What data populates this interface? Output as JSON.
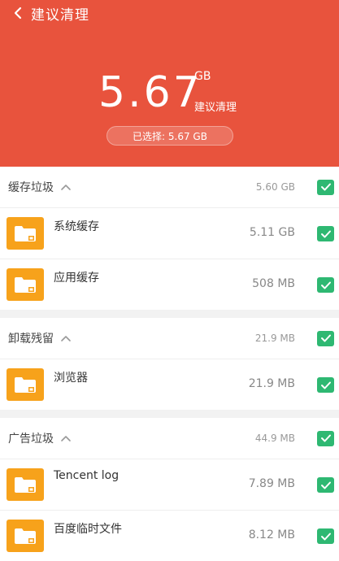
{
  "header": {
    "title": "建议清理",
    "size_value": "5.67",
    "size_unit": "GB",
    "size_label": "建议清理",
    "selected_text": "已选择: 5.67 GB",
    "background_color": "#e8533d"
  },
  "groups": [
    {
      "title": "缓存垃圾",
      "size": "5.60 GB",
      "checked": true,
      "items": [
        {
          "name": "系统缓存",
          "size": "5.11 GB",
          "checked": true
        },
        {
          "name": "应用缓存",
          "size": "508 MB",
          "checked": true
        }
      ]
    },
    {
      "title": "卸载残留",
      "size": "21.9 MB",
      "checked": true,
      "items": [
        {
          "name": "浏览器",
          "size": "21.9 MB",
          "checked": true
        }
      ]
    },
    {
      "title": "广告垃圾",
      "size": "44.9 MB",
      "checked": true,
      "items": [
        {
          "name": "Tencent log",
          "size": "7.89 MB",
          "checked": true
        },
        {
          "name": "百度临时文件",
          "size": "8.12 MB",
          "checked": true
        }
      ]
    }
  ],
  "icons": {
    "back": "chevron-left-icon",
    "collapse": "chevron-up-icon",
    "folder": "folder-icon",
    "check": "checkbox-checked-icon"
  },
  "colors": {
    "accent": "#e8533d",
    "check": "#2eb872",
    "folder": "#f7a21b"
  }
}
